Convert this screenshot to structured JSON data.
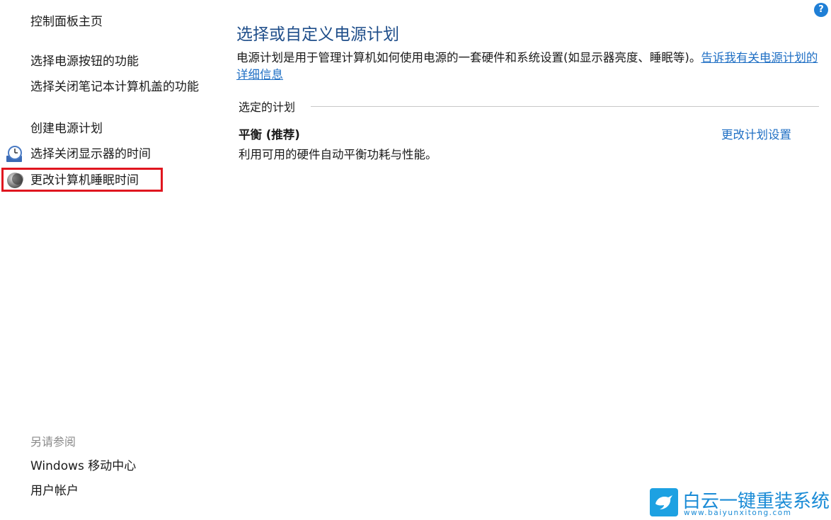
{
  "sidebar": {
    "home_link": "控制面板主页",
    "links": [
      "选择电源按钮的功能",
      "选择关闭笔记本计算机盖的功能",
      "创建电源计划",
      "选择关闭显示器的时间",
      "更改计算机睡眠时间"
    ],
    "see_also_label": "另请参阅",
    "see_also": [
      "Windows 移动中心",
      "用户帐户"
    ]
  },
  "main": {
    "title": "选择或自定义电源计划",
    "description": "电源计划是用于管理计算机如何使用电源的一套硬件和系统设置(如显示器亮度、睡眠等)。",
    "description_link": "告诉我有关电源计划的详细信息",
    "section_label": "选定的计划",
    "plan": {
      "name": "平衡 (推荐)",
      "description": "利用可用的硬件自动平衡功耗与性能。",
      "change_link": "更改计划设置"
    }
  },
  "help_button": "?",
  "watermark": {
    "text": "白云一键重装系统",
    "url": "www.baiyunxitong.com"
  },
  "colors": {
    "title": "#1f4e8a",
    "link": "#1f6fc4",
    "highlight": "#e0161f"
  }
}
